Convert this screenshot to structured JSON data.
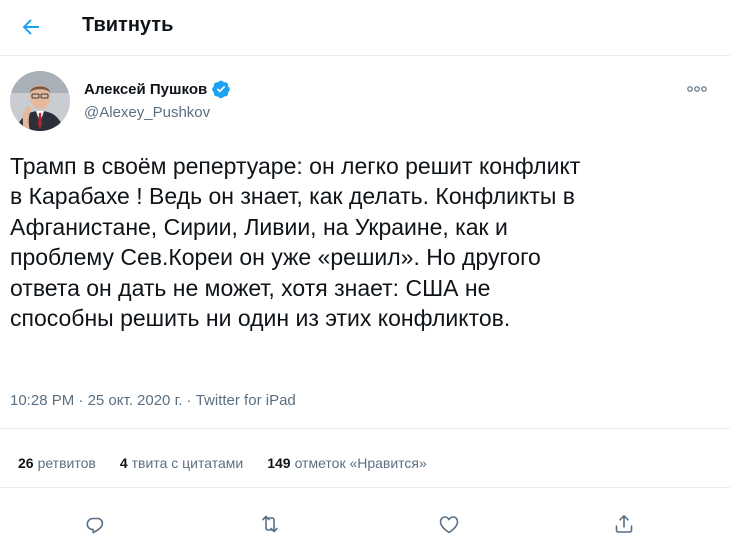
{
  "header": {
    "title": "Твитнуть",
    "back_icon": "arrow-left-icon"
  },
  "author": {
    "display_name": "Алексей Пушков",
    "handle": "@Alexey_Pushkov",
    "verified_icon": "verified-badge-icon"
  },
  "tweet": {
    "text": "Трамп в своём репертуаре: он легко решит конфликт\nв Карабахе ! Ведь он знает, как делать. Конфликты в\nАфганистане, Сирии, Ливии, на Украине, как и\nпроблему Сев.Кореи он уже «решил». Но другого\nответа он дать не может, хотя знает: США не\nспособны решить ни один из этих конфликтов.",
    "time": "10:28 PM",
    "sep": " · ",
    "date": "25 окт. 2020 г.",
    "source": "Twitter for iPad"
  },
  "stats": {
    "retweets_count": "26",
    "retweets_label": "ретвитов",
    "quotes_count": "4",
    "quotes_label": "твита с цитатами",
    "likes_count": "149",
    "likes_label": "отметок «Нравится»"
  },
  "actions": [
    "reply-icon",
    "retweet-icon",
    "like-icon",
    "share-icon"
  ],
  "colors": {
    "accent": "#1da1f2",
    "secondary_text": "#5b7083",
    "divider": "#e6ecf0"
  }
}
